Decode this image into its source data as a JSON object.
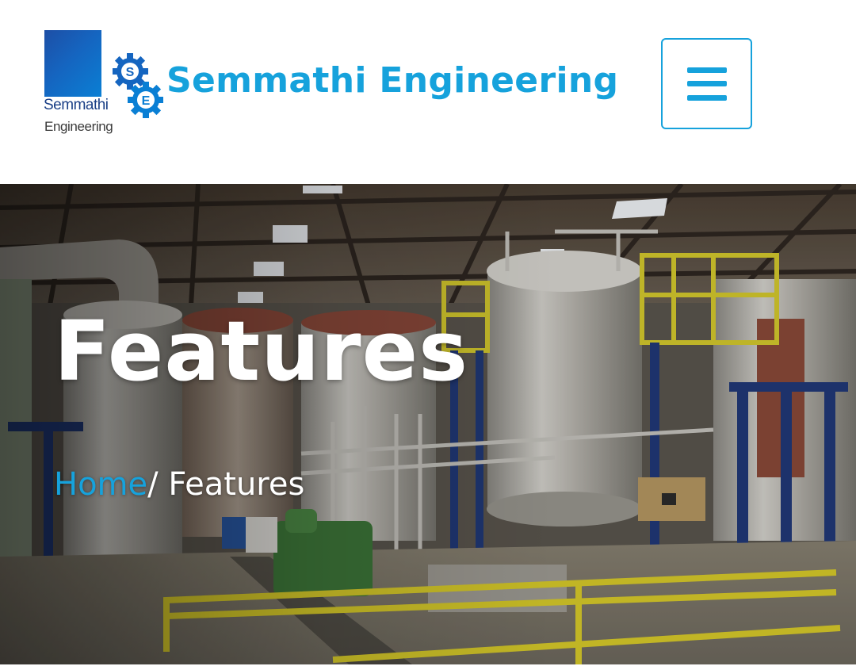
{
  "header": {
    "logo": {
      "word_top": "Semmathi",
      "word_bottom": "Engineering",
      "gear_letters": [
        "S",
        "E"
      ]
    },
    "brand_name": "Semmathi Engineering",
    "menu_icon": "hamburger-menu-icon"
  },
  "hero": {
    "title": "Features",
    "breadcrumb": {
      "home": "Home",
      "separator": "/",
      "current": " Features"
    }
  },
  "colors": {
    "brand_blue": "#16a2dc",
    "logo_dark_blue": "#1a3f86",
    "white": "#ffffff"
  }
}
